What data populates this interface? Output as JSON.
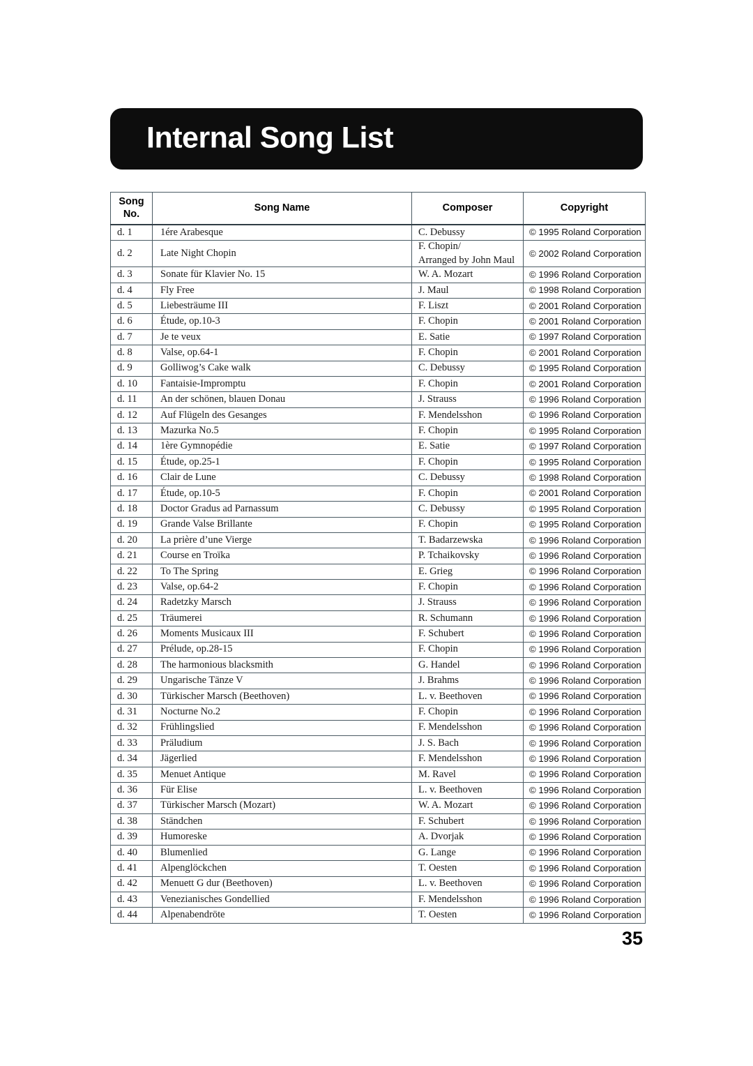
{
  "document": {
    "title": "Internal Song List",
    "page_number": "35"
  },
  "table": {
    "headers": {
      "song_no_line1": "Song",
      "song_no_line2": "No.",
      "song_name": "Song Name",
      "composer": "Composer",
      "copyright": "Copyright"
    },
    "rows": [
      {
        "no": "d. 1",
        "name": "1ére Arabesque",
        "composer": [
          "C. Debussy"
        ],
        "copyright": "© 1995 Roland Corporation"
      },
      {
        "no": "d. 2",
        "name": "Late Night Chopin",
        "composer": [
          "F. Chopin/",
          "Arranged by John Maul"
        ],
        "copyright": "© 2002 Roland Corporation"
      },
      {
        "no": "d. 3",
        "name": "Sonate für Klavier No. 15",
        "composer": [
          "W. A. Mozart"
        ],
        "copyright": "© 1996 Roland Corporation"
      },
      {
        "no": "d. 4",
        "name": "Fly Free",
        "composer": [
          "J. Maul"
        ],
        "copyright": "© 1998 Roland Corporation"
      },
      {
        "no": "d. 5",
        "name": "Liebesträume III",
        "composer": [
          "F. Liszt"
        ],
        "copyright": "© 2001 Roland Corporation"
      },
      {
        "no": "d. 6",
        "name": "Étude, op.10-3",
        "composer": [
          "F. Chopin"
        ],
        "copyright": "© 2001 Roland Corporation"
      },
      {
        "no": "d. 7",
        "name": "Je te veux",
        "composer": [
          "E. Satie"
        ],
        "copyright": "© 1997 Roland Corporation"
      },
      {
        "no": "d. 8",
        "name": "Valse, op.64-1",
        "composer": [
          "F. Chopin"
        ],
        "copyright": "© 2001 Roland Corporation"
      },
      {
        "no": "d. 9",
        "name": "Golliwog’s Cake walk",
        "composer": [
          "C. Debussy"
        ],
        "copyright": "© 1995 Roland Corporation"
      },
      {
        "no": "d. 10",
        "name": "Fantaisie-Impromptu",
        "composer": [
          "F. Chopin"
        ],
        "copyright": "© 2001 Roland Corporation"
      },
      {
        "no": "d. 11",
        "name": "An der schönen, blauen Donau",
        "composer": [
          "J. Strauss"
        ],
        "copyright": "© 1996 Roland Corporation"
      },
      {
        "no": "d. 12",
        "name": "Auf Flügeln des Gesanges",
        "composer": [
          "F. Mendelsshon"
        ],
        "copyright": "© 1996 Roland Corporation"
      },
      {
        "no": "d. 13",
        "name": "Mazurka No.5",
        "composer": [
          "F. Chopin"
        ],
        "copyright": "© 1995 Roland Corporation"
      },
      {
        "no": "d. 14",
        "name": "1ère Gymnopédie",
        "composer": [
          "E. Satie"
        ],
        "copyright": "© 1997 Roland Corporation"
      },
      {
        "no": "d. 15",
        "name": "Étude, op.25-1",
        "composer": [
          "F. Chopin"
        ],
        "copyright": "© 1995 Roland Corporation"
      },
      {
        "no": "d. 16",
        "name": "Clair de Lune",
        "composer": [
          "C. Debussy"
        ],
        "copyright": "© 1998 Roland Corporation"
      },
      {
        "no": "d. 17",
        "name": "Étude, op.10-5",
        "composer": [
          "F. Chopin"
        ],
        "copyright": "© 2001 Roland Corporation"
      },
      {
        "no": "d. 18",
        "name": "Doctor Gradus ad Parnassum",
        "composer": [
          "C. Debussy"
        ],
        "copyright": "© 1995 Roland Corporation"
      },
      {
        "no": "d. 19",
        "name": "Grande Valse Brillante",
        "composer": [
          "F. Chopin"
        ],
        "copyright": "© 1995 Roland Corporation"
      },
      {
        "no": "d. 20",
        "name": "La prière d’une Vierge",
        "composer": [
          "T. Badarzewska"
        ],
        "copyright": "© 1996 Roland Corporation"
      },
      {
        "no": "d. 21",
        "name": "Course en Troïka",
        "composer": [
          "P. Tchaikovsky"
        ],
        "copyright": "© 1996 Roland Corporation"
      },
      {
        "no": "d. 22",
        "name": "To The Spring",
        "composer": [
          "E. Grieg"
        ],
        "copyright": "© 1996 Roland Corporation"
      },
      {
        "no": "d. 23",
        "name": "Valse, op.64-2",
        "composer": [
          "F. Chopin"
        ],
        "copyright": "© 1996 Roland Corporation"
      },
      {
        "no": "d. 24",
        "name": "Radetzky Marsch",
        "composer": [
          "J. Strauss"
        ],
        "copyright": "© 1996 Roland Corporation"
      },
      {
        "no": "d. 25",
        "name": "Träumerei",
        "composer": [
          "R. Schumann"
        ],
        "copyright": "© 1996 Roland Corporation"
      },
      {
        "no": "d. 26",
        "name": "Moments Musicaux III",
        "composer": [
          "F. Schubert"
        ],
        "copyright": "© 1996 Roland Corporation"
      },
      {
        "no": "d. 27",
        "name": "Prélude, op.28-15",
        "composer": [
          "F. Chopin"
        ],
        "copyright": "© 1996 Roland Corporation"
      },
      {
        "no": "d. 28",
        "name": "The harmonious blacksmith",
        "composer": [
          "G. Handel"
        ],
        "copyright": "© 1996 Roland Corporation"
      },
      {
        "no": "d. 29",
        "name": "Ungarische Tänze V",
        "composer": [
          "J. Brahms"
        ],
        "copyright": "© 1996 Roland Corporation"
      },
      {
        "no": "d. 30",
        "name": "Türkischer Marsch (Beethoven)",
        "composer": [
          "L. v. Beethoven"
        ],
        "copyright": "© 1996 Roland Corporation"
      },
      {
        "no": "d. 31",
        "name": "Nocturne No.2",
        "composer": [
          "F. Chopin"
        ],
        "copyright": "© 1996 Roland Corporation"
      },
      {
        "no": "d. 32",
        "name": "Frühlingslied",
        "composer": [
          "F. Mendelsshon"
        ],
        "copyright": "© 1996 Roland Corporation"
      },
      {
        "no": "d. 33",
        "name": "Präludium",
        "composer": [
          "J. S. Bach"
        ],
        "copyright": "© 1996 Roland Corporation"
      },
      {
        "no": "d. 34",
        "name": "Jägerlied",
        "composer": [
          "F. Mendelsshon"
        ],
        "copyright": "© 1996 Roland Corporation"
      },
      {
        "no": "d. 35",
        "name": "Menuet Antique",
        "composer": [
          "M. Ravel"
        ],
        "copyright": "© 1996 Roland Corporation"
      },
      {
        "no": "d. 36",
        "name": "Für Elise",
        "composer": [
          "L. v. Beethoven"
        ],
        "copyright": "© 1996 Roland Corporation"
      },
      {
        "no": "d. 37",
        "name": "Türkischer Marsch (Mozart)",
        "composer": [
          "W. A. Mozart"
        ],
        "copyright": "© 1996 Roland Corporation"
      },
      {
        "no": "d. 38",
        "name": "Ständchen",
        "composer": [
          "F. Schubert"
        ],
        "copyright": "© 1996 Roland Corporation"
      },
      {
        "no": "d. 39",
        "name": "Humoreske",
        "composer": [
          "A. Dvorjak"
        ],
        "copyright": "© 1996 Roland Corporation"
      },
      {
        "no": "d. 40",
        "name": "Blumenlied",
        "composer": [
          "G. Lange"
        ],
        "copyright": "© 1996 Roland Corporation"
      },
      {
        "no": "d. 41",
        "name": "Alpenglöckchen",
        "composer": [
          "T. Oesten"
        ],
        "copyright": "© 1996 Roland Corporation"
      },
      {
        "no": "d. 42",
        "name": "Menuett G dur (Beethoven)",
        "composer": [
          "L. v. Beethoven"
        ],
        "copyright": "© 1996 Roland Corporation"
      },
      {
        "no": "d. 43",
        "name": "Venezianisches Gondellied",
        "composer": [
          "F. Mendelsshon"
        ],
        "copyright": "© 1996 Roland Corporation"
      },
      {
        "no": "d. 44",
        "name": "Alpenabendröte",
        "composer": [
          "T. Oesten"
        ],
        "copyright": "© 1996 Roland Corporation"
      }
    ]
  }
}
